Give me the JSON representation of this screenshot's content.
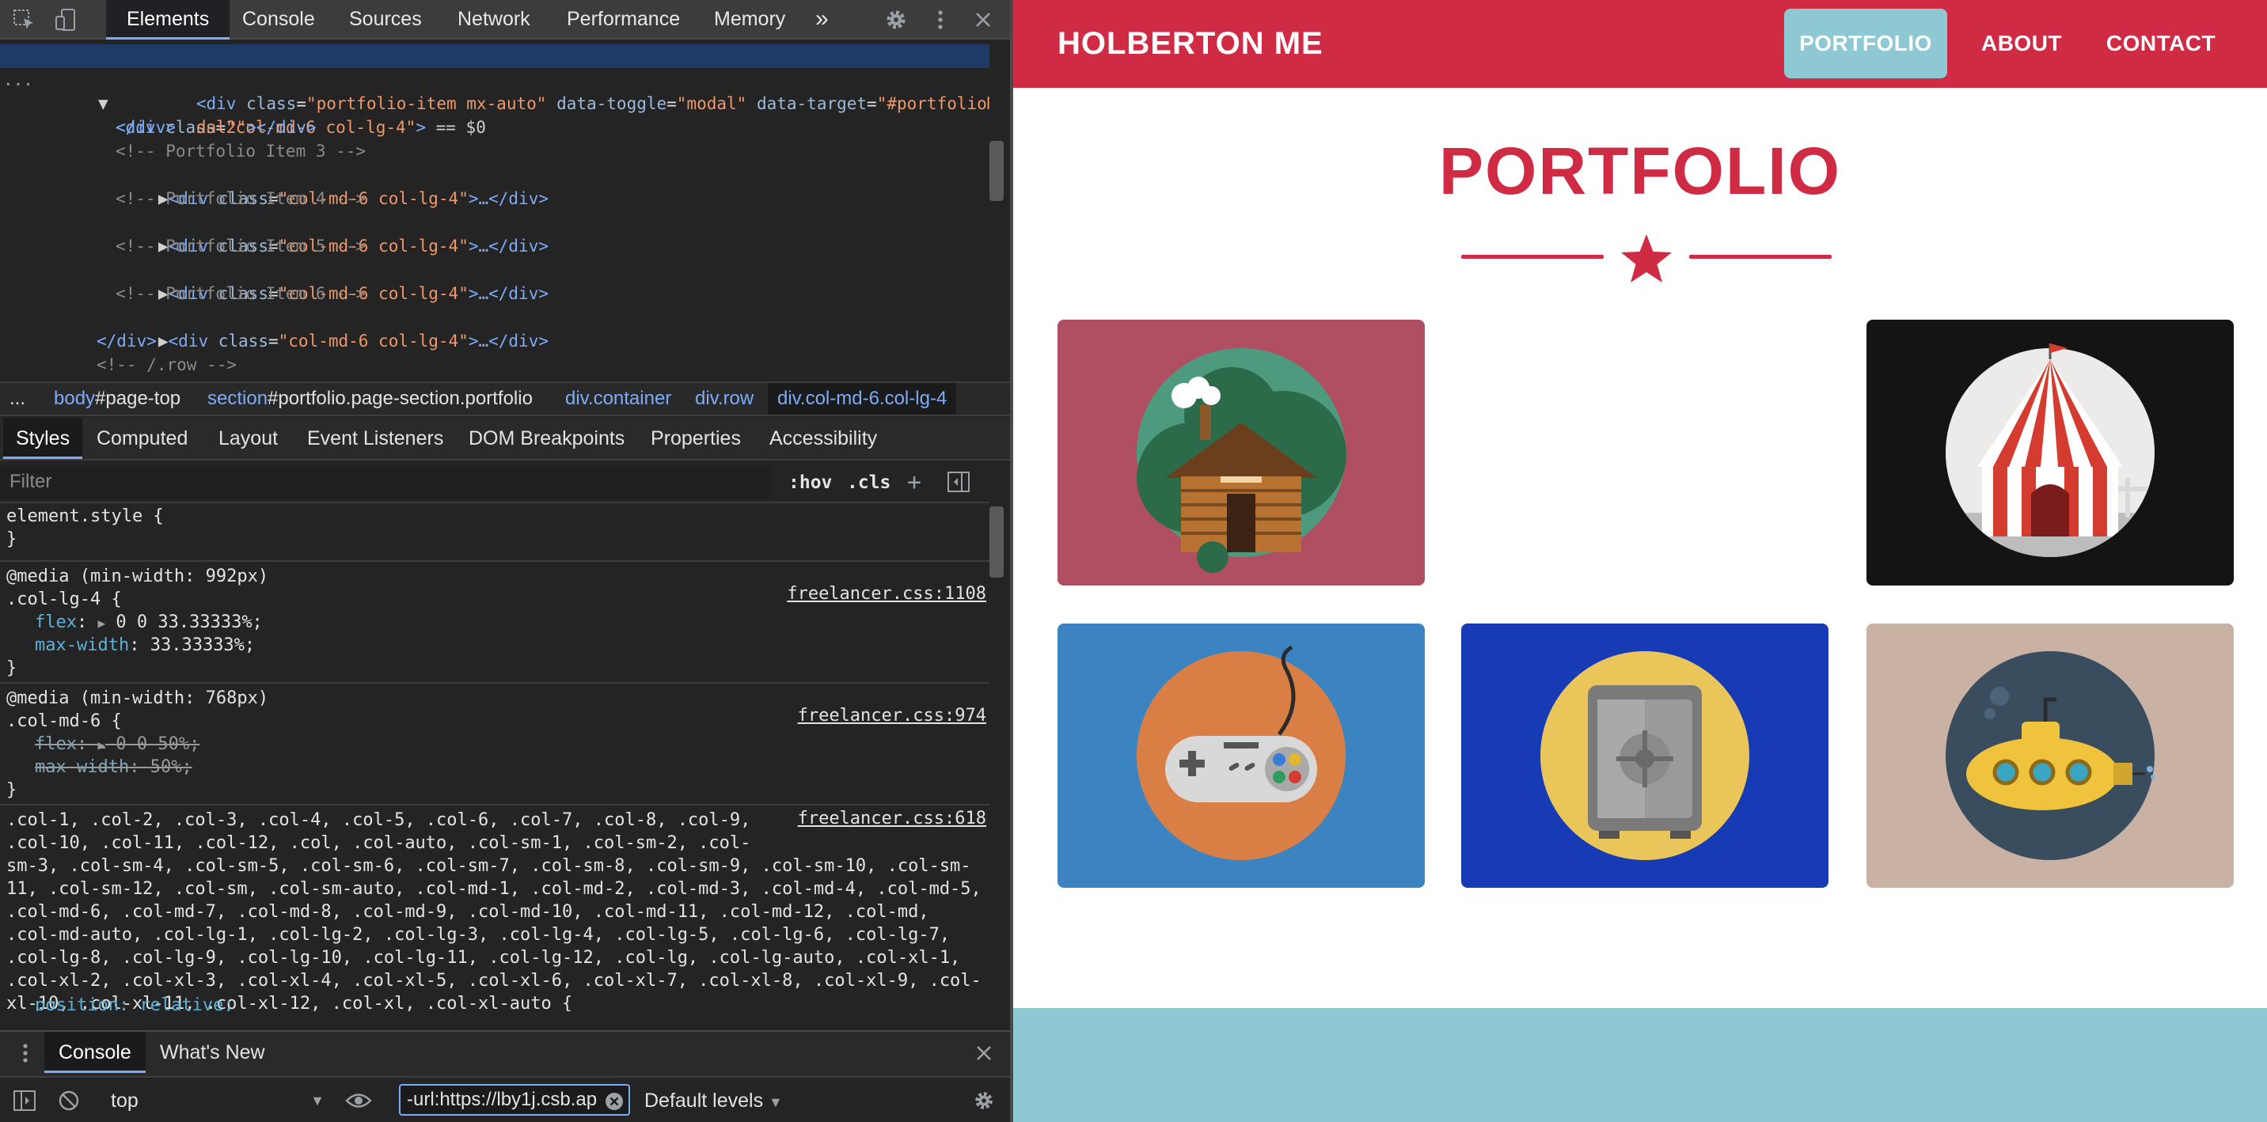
{
  "devtools": {
    "tabs": [
      "Elements",
      "Console",
      "Sources",
      "Network",
      "Performance",
      "Memory"
    ],
    "more_tabs": "»",
    "dom": {
      "ellipsis": "...",
      "selected": {
        "open": "<div",
        "attr": "class",
        "val": "\"col-md-6 col-lg-4\"",
        "close": ">",
        "marker": " == $0"
      },
      "child": {
        "open": "<div",
        "a1": "class",
        "v1": "\"portfolio-item mx-auto\"",
        "a2": "data-toggle",
        "v2": "\"modal\"",
        "a3": "data-target",
        "v3": "\"#portfolioMo",
        "wrap": "dal2\"",
        "close": "></div>"
      },
      "close_div": "</div>",
      "collapsed_tag": "<div",
      "collapsed_attr": "class",
      "collapsed_val": "\"col-md-6 col-lg-4\"",
      "collapsed_rest": ">…</div>",
      "comments": [
        "<!-- Portfolio Item 3 -->",
        "<!-- Portfolio Item 4 -->",
        "<!-- Portfolio Item 5 -->",
        "<!-- Portfolio Item 6 -->"
      ],
      "row_comment": "<!-- /.row -->"
    },
    "breadcrumbs": {
      "more": "...",
      "items": [
        {
          "tag": "body",
          "id": "#page-top"
        },
        {
          "tag": "section",
          "id": "#portfolio.page-section.portfolio"
        },
        {
          "tag": "div.container",
          "id": ""
        },
        {
          "tag": "div.row",
          "id": ""
        },
        {
          "tag": "div.col-md-6.col-lg-4",
          "id": ""
        }
      ]
    },
    "subtabs": [
      "Styles",
      "Computed",
      "Layout",
      "Event Listeners",
      "DOM Breakpoints",
      "Properties",
      "Accessibility"
    ],
    "filter": {
      "placeholder": "Filter",
      "hov": ":hov",
      "cls": ".cls",
      "plus": "+"
    },
    "styles": {
      "element_style": "element.style {",
      "close_brace": "}",
      "rule1": {
        "media": "@media (min-width: 992px)",
        "selector": ".col-lg-4 {",
        "source": "freelancer.css:1108",
        "p1": "flex",
        "v1": "0 0 33.33333%;",
        "p2": "max-width",
        "v2": "33.33333%;"
      },
      "rule2": {
        "media": "@media (min-width: 768px)",
        "selector": ".col-md-6 {",
        "source": "freelancer.css:974",
        "p1": "flex",
        "v1": "0 0 50%;",
        "p2": "max-width",
        "v2": "50%;"
      },
      "rule3": {
        "source": "freelancer.css:618",
        "lines": [
          ".col-1, .col-2, .col-3, .col-4, .col-5, .col-6, .col-7, .col-8, .col-9,",
          ".col-10, .col-11, .col-12, .col, .col-auto, .col-sm-1, .col-sm-2, .col-",
          "sm-3, .col-sm-4, .col-sm-5, .col-sm-6, .col-sm-7, .col-sm-8, .col-sm-9, .col-sm-10, .col-sm-",
          "11, .col-sm-12, .col-sm, .col-sm-auto, .col-md-1, .col-md-2, .col-md-3, .col-md-4, .col-md-5,",
          ".col-md-6, .col-md-7, .col-md-8, .col-md-9, .col-md-10, .col-md-11, .col-md-12, .col-md,",
          ".col-md-auto, .col-lg-1, .col-lg-2, .col-lg-3, .col-lg-4, .col-lg-5, .col-lg-6, .col-lg-7,",
          ".col-lg-8, .col-lg-9, .col-lg-10, .col-lg-11, .col-lg-12, .col-lg, .col-lg-auto, .col-xl-1,",
          ".col-xl-2, .col-xl-3, .col-xl-4, .col-xl-5, .col-xl-6, .col-xl-7, .col-xl-8, .col-xl-9, .col-",
          "xl-10, .col-xl-11, .col-xl-12, .col-xl, .col-xl-auto {"
        ],
        "partial": "position: relative;"
      }
    },
    "drawer": {
      "tabs": [
        "Console",
        "What's New"
      ],
      "context": "top",
      "url_filter": "-url:https://lby1j.csb.ap",
      "levels": "Default levels"
    }
  },
  "site": {
    "brand": "HOLBERTON ME",
    "nav": [
      "PORTFOLIO",
      "ABOUT",
      "CONTACT"
    ],
    "heading": "PORTFOLIO",
    "colors": {
      "primary": "#d02b45",
      "accent": "#8ec9d3"
    },
    "items": [
      {
        "name": "cabin",
        "bg": "#b04e62"
      },
      {
        "name": "circus-tent",
        "bg": "#141414"
      },
      {
        "name": "game-controller",
        "bg": "#3b83c1"
      },
      {
        "name": "safe",
        "bg": "#173ab5"
      },
      {
        "name": "submarine",
        "bg": "#c9b1a4"
      }
    ]
  }
}
